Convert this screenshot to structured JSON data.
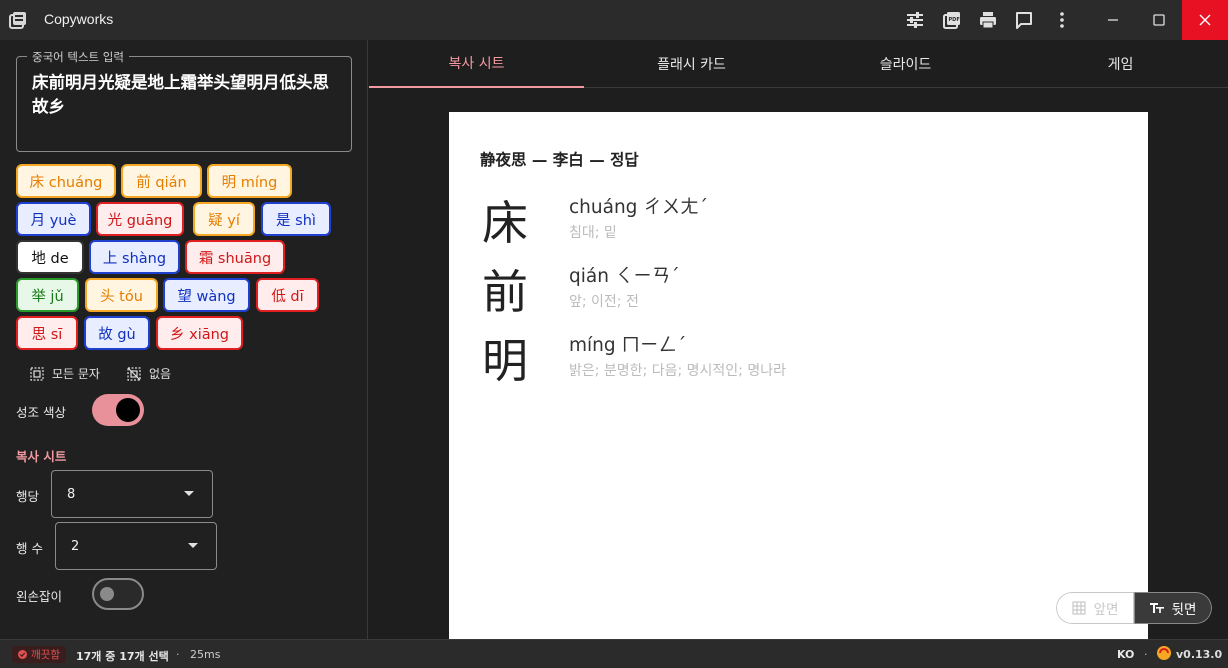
{
  "app": {
    "title": "Copyworks",
    "version": "v0.13.0",
    "language": "KO"
  },
  "sidebar": {
    "input_legend": "중국어 텍스트 입력",
    "input_value": "床前明月光疑是地上霜举头望明月低头思故乡",
    "chips": [
      {
        "label": "床 chuáng",
        "tone": "orange"
      },
      {
        "label": "前 qián",
        "tone": "orange"
      },
      {
        "label": "明 míng",
        "tone": "orange"
      },
      {
        "label": "月 yuè",
        "tone": "blue"
      },
      {
        "label": "光 guāng",
        "tone": "red"
      },
      {
        "label": "疑 yí",
        "tone": "orange"
      },
      {
        "label": "是 shì",
        "tone": "blue"
      },
      {
        "label": "地 de",
        "tone": "black"
      },
      {
        "label": "上 shàng",
        "tone": "blue"
      },
      {
        "label": "霜 shuāng",
        "tone": "red"
      },
      {
        "label": "举 jǔ",
        "tone": "green"
      },
      {
        "label": "头 tóu",
        "tone": "orange"
      },
      {
        "label": "望 wàng",
        "tone": "blue"
      },
      {
        "label": "低 dī",
        "tone": "red"
      },
      {
        "label": "思 sī",
        "tone": "red"
      },
      {
        "label": "故 gù",
        "tone": "blue"
      },
      {
        "label": "乡 xiāng",
        "tone": "red"
      }
    ],
    "select_all": "모든 문자",
    "select_none": "없음",
    "tone_color_label": "성조 색상",
    "tone_color_on": true,
    "section_copy_sheet": "복사 시트",
    "per_row_label": "행당",
    "per_row_value": "8",
    "rows_label": "행 수",
    "rows_value": "2",
    "left_handed_label": "왼손잡이",
    "left_handed_on": false
  },
  "tabs": [
    "복사 시트",
    "플래시 카드",
    "슬라이드",
    "게임"
  ],
  "active_tab": 0,
  "sheet": {
    "title": "静夜思 — 李白 — 정답",
    "rows": [
      {
        "hanzi": "床",
        "pinyin": "chuáng ㄔㄨㄤˊ",
        "meaning": "침대; 밑"
      },
      {
        "hanzi": "前",
        "pinyin": "qián ㄑㄧㄢˊ",
        "meaning": "앞; 이전; 전"
      },
      {
        "hanzi": "明",
        "pinyin": "míng ㄇㄧㄥˊ",
        "meaning": "밝은; 분명한; 다음; 명시적인; 명나라"
      }
    ]
  },
  "side_toggle": {
    "front": "앞면",
    "back": "뒷면"
  },
  "status": {
    "badge": "깨끗함",
    "selection": "17개 중 17개 선택",
    "timing": "25ms"
  },
  "colors": {
    "accent": "#f29aa2",
    "tone_orange": "#f5a623",
    "tone_blue": "#2040d0",
    "tone_red": "#e02020",
    "tone_green": "#2a9a2a",
    "tone_neutral": "#333333",
    "close_red": "#e81123"
  }
}
